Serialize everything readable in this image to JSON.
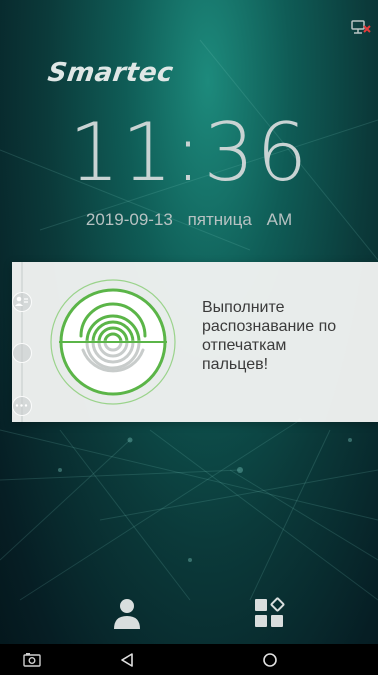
{
  "brand": {
    "logo_text": "Smartec"
  },
  "clock": {
    "time": "11:36",
    "date": "2019-09-13",
    "weekday": "пятница",
    "ampm": "AM"
  },
  "card": {
    "message": "Выполните\nраспознавание по\nотпечаткам\nпальцев!"
  },
  "side_rail": {
    "icons": [
      "user-card-icon",
      "face-icon",
      "more-dots-icon"
    ]
  },
  "bottom_bar": {
    "icons": [
      "user-icon",
      "apps-grid-icon"
    ]
  },
  "navbar": {
    "icons": [
      "screenshot-icon",
      "back-icon",
      "home-icon"
    ]
  },
  "colors": {
    "accent_green": "#5bb548",
    "card_bg": "#f0f2f1",
    "status_red": "#e23b3b"
  }
}
